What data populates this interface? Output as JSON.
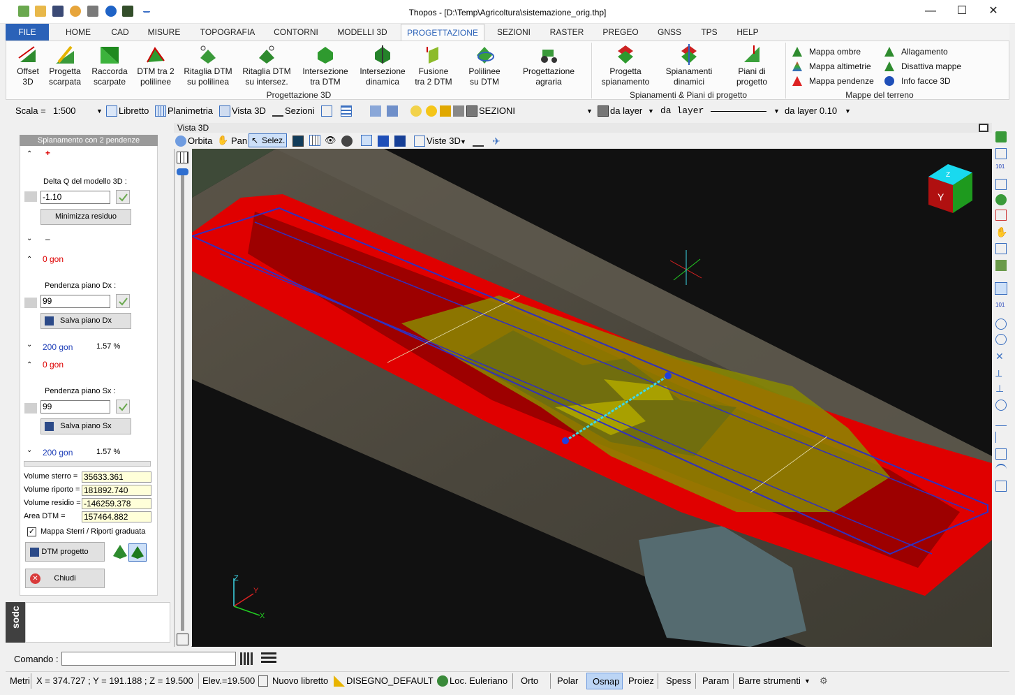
{
  "window": {
    "title": "Thopos - [D:\\Temp\\Agricoltura\\sistemazione_orig.thp]",
    "minimize": "—",
    "maximize": "☐",
    "close": "✕"
  },
  "tabs": [
    "FILE",
    "HOME",
    "CAD",
    "MISURE",
    "TOPOGRAFIA",
    "CONTORNI",
    "MODELLI 3D",
    "PROGETTAZIONE",
    "SEZIONI",
    "RASTER",
    "PREGEO",
    "GNSS",
    "TPS",
    "HELP"
  ],
  "ribbon": {
    "group1": {
      "label": "Progettazione 3D",
      "buttons": [
        {
          "l1": "Offset",
          "l2": "3D"
        },
        {
          "l1": "Progetta",
          "l2": "scarpata"
        },
        {
          "l1": "Raccorda",
          "l2": "scarpate"
        },
        {
          "l1": "DTM tra 2",
          "l2": "polilinee"
        },
        {
          "l1": "Ritaglia DTM",
          "l2": "su polilinea"
        },
        {
          "l1": "Ritaglia DTM",
          "l2": "su intersez."
        },
        {
          "l1": "Intersezione",
          "l2": "tra DTM"
        },
        {
          "l1": "Intersezione",
          "l2": "dinamica"
        },
        {
          "l1": "Fusione",
          "l2": "tra 2 DTM"
        },
        {
          "l1": "Polilinee",
          "l2": "su DTM"
        },
        {
          "l1": "Progettazione",
          "l2": "agraria"
        }
      ]
    },
    "group2": {
      "label": "Spianamenti & Piani di progetto",
      "buttons": [
        {
          "l1": "Progetta",
          "l2": "spianamento"
        },
        {
          "l1": "Spianamenti",
          "l2": "dinamici"
        },
        {
          "l1": "Piani di",
          "l2": "progetto"
        }
      ]
    },
    "group3": {
      "label": "Mappe del terreno",
      "items": [
        "Mappa ombre",
        "Mappa altimetrie",
        "Mappa pendenze",
        "Allagamento",
        "Disattiva mappe",
        "Info facce 3D"
      ]
    }
  },
  "toolbar": {
    "scala_label": "Scala =",
    "scala_value": "1:500",
    "libretto": "Libretto",
    "planimetria": "Planimetria",
    "vista3d": "Vista 3D",
    "sezioni": "Sezioni",
    "layer": "SEZIONI",
    "color_layer": "da layer",
    "linetype": "da layer",
    "lineweight": "da layer 0.10"
  },
  "panel": {
    "title": "Spianamento con 2 pendenze",
    "plus": "+",
    "minus": "–",
    "delta_label": "Delta Q del modello 3D :",
    "delta_value": "-1.10",
    "minimizza": "Minimizza residuo",
    "dx_angle_top": "0 gon",
    "dx_label": "Pendenza piano Dx :",
    "dx_value": "99",
    "salva_dx": "Salva piano Dx",
    "dx_angle_bottom": "200 gon",
    "dx_pct": "1.57 %",
    "sx_angle_top": "0 gon",
    "sx_label": "Pendenza piano Sx :",
    "sx_value": "99",
    "salva_sx": "Salva piano Sx",
    "sx_angle_bottom": "200 gon",
    "sx_pct": "1.57 %",
    "vol_sterro_label": "Volume sterro =",
    "vol_sterro": "35633.361",
    "vol_riporto_label": "Volume riporto =",
    "vol_riporto": "181892.740",
    "vol_residio_label": "Volume residio =",
    "vol_residio": "-146259.378",
    "area_label": "Area DTM =",
    "area": "157464.882",
    "checkbox_label": "Mappa Sterri / Riporti graduata",
    "dtm_btn": "DTM progetto",
    "chiudi": "Chiudi",
    "side_label": "sodc"
  },
  "viewport": {
    "title": "Vista 3D",
    "orbita": "Orbita",
    "pan": "Pan",
    "selez": "Selez.",
    "viste": "Viste 3D",
    "axes": {
      "z": "Z",
      "y": "Y",
      "x": "X"
    },
    "cube_face": "Y",
    "cube_top": "Z"
  },
  "command": {
    "label": "Comando :",
    "value": ""
  },
  "status": {
    "units": "Metri",
    "coords": "X = 374.727 ; Y = 191.188 ; Z = 19.500",
    "elev": "Elev.=19.500",
    "libretto": "Nuovo libretto",
    "disegno": "DISEGNO_DEFAULT",
    "loc": "Loc. Euleriano",
    "orto": "Orto",
    "polar": "Polar",
    "osnap": "Osnap",
    "proiez": "Proiez",
    "spess": "Spess",
    "param": "Param",
    "barre": "Barre strumenti"
  },
  "colors": {
    "accent": "#2b62b8",
    "red": "#e00000",
    "yellow": "#8a8a00"
  }
}
